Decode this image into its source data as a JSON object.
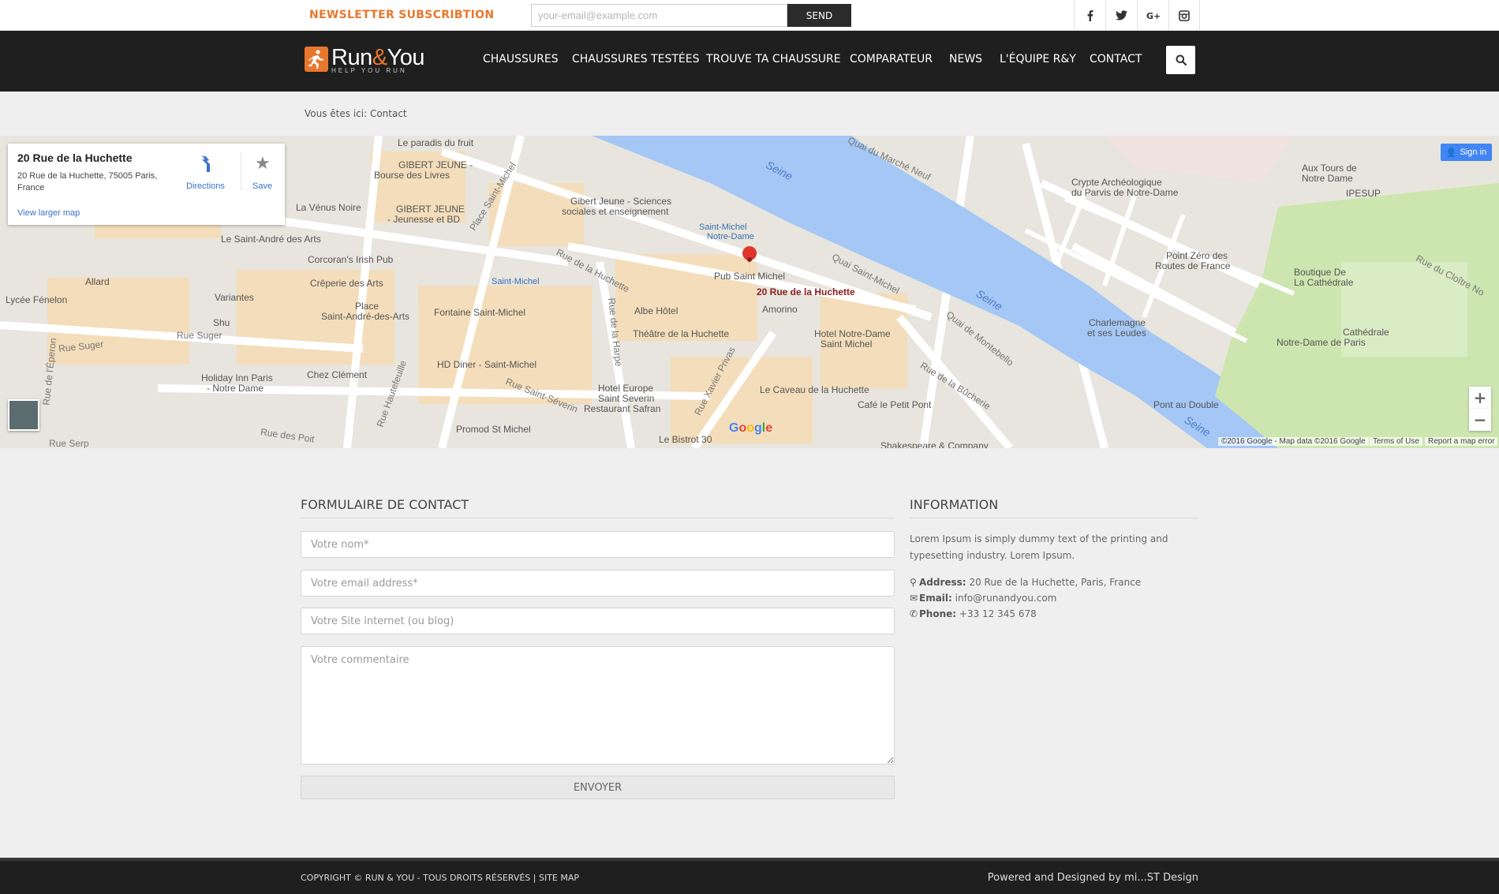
{
  "topbar": {
    "newsletter_label": "NEWSLETTER SUBSCRIBTION",
    "email_placeholder": "your-email@example.com",
    "send_label": "SEND",
    "social": [
      "f",
      "t",
      "g+",
      "ig"
    ]
  },
  "brand": {
    "name_part1": "Run",
    "name_amp": "&",
    "name_part2": "You",
    "tagline": "HELP YOU RUN"
  },
  "nav": {
    "items": [
      "CHAUSSURES",
      "CHAUSSURES TESTÉES",
      "TROUVE TA CHAUSSURE",
      "COMPARATEUR",
      "NEWS",
      "L'ÉQUIPE R&Y",
      "CONTACT"
    ]
  },
  "breadcrumb": "Vous êtes ici: Contact",
  "map": {
    "card_title": "20 Rue de la Huchette",
    "card_address": "20 Rue de la Huchette, 75005 Paris, France",
    "directions": "Directions",
    "save": "Save",
    "larger_map": "View larger map",
    "sign_in": "Sign in",
    "pin_label": "20 Rue de la Huchette",
    "google": "Google",
    "copyright": "©2016 Google - Map data ©2016 Google",
    "terms": "Terms of Use",
    "report": "Report a map error",
    "labels": [
      "Le paradis du fruit",
      "GIBERT JEUNE -",
      "Bourse des Livres",
      "La Vénus Noire",
      "GIBERT JEUNE",
      "- Jeunesse et BD",
      "Gibert Jeune - Sciences",
      "sociales et enseignement",
      "Saint-Michel",
      "Notre-Dame",
      "Seine",
      "Crypte Archéologique",
      "du Parvis de Notre-Dame",
      "Aux Tours de",
      "Notre Dame",
      "IPESUP",
      "Le Saint-André des Arts",
      "Corcoran's Irish Pub",
      "Allard",
      "Crêperie des Arts",
      "Lycée Fénelon",
      "Variantes",
      "Saint-Michel",
      "Pub Saint Michel",
      "Point Zéro des",
      "Routes de France",
      "Boutique De",
      "La Cathédrale",
      "Place",
      "Saint-André-des-Arts",
      "Fontaine Saint-Michel",
      "Albe Hôtel",
      "Amorino",
      "Rue Suger",
      "Shu",
      "Théâtre de la Huchette",
      "Hotel Notre-Dame",
      "Saint Michel",
      "Charlemagne",
      "et ses Leudes",
      "Cathédrale",
      "Notre-Dame de Paris",
      "Rue Suger",
      "Holiday Inn Paris",
      "- Notre Dame",
      "Chez Clément",
      "HD Diner - Saint-Michel",
      "Hotel Europe",
      "Saint Severin",
      "Restaurant Safran",
      "Le Caveau de la Huchette",
      "Café le Petit Pont",
      "Promod St Michel",
      "Le Bistrot 30",
      "Pont au Double",
      "Shakespeare & Company",
      "Quai du Marché Neuf",
      "Quai Saint-Michel",
      "Quai de Montebello",
      "Rue de la Bûcherie",
      "Rue du Cloître No",
      "Rue de la Huchette",
      "Rue de la Harpe",
      "Rue Saint-Séverin",
      "Rue Xavier Privas",
      "Rue Hautefeuille",
      "Place Saint-Michel",
      "Rue des Poit",
      "Rue Serp",
      "Rue de l'Éperon",
      "Seine",
      "Seine"
    ]
  },
  "contact": {
    "form_title": "FORMULAIRE DE CONTACT",
    "name_placeholder": "Votre nom*",
    "email_placeholder": "Votre email address*",
    "site_placeholder": "Votre Site internet (ou blog)",
    "comment_placeholder": "Votre commentaire",
    "submit": "ENVOYER"
  },
  "info": {
    "title": "INFORMATION",
    "text": "Lorem Ipsum is simply dummy text of the printing and typesetting industry. Lorem Ipsum.",
    "address_label": "Address:",
    "address_value": "20 Rue de la Huchette, Paris, France",
    "email_label": "Email:",
    "email_value": "info@runandyou.com",
    "phone_label": "Phone:",
    "phone_value": "+33 12 345 678"
  },
  "footer": {
    "left": "COPYRIGHT © RUN & YOU - TOUS DROITS RÉSERVÉS | SITE MAP",
    "right": "Powered and Designed by mi...ST Design"
  },
  "colors": {
    "accent": "#e8772e",
    "dark": "#1f1f1f",
    "map_water": "#a4c7f5",
    "map_park": "#cde6b0"
  }
}
